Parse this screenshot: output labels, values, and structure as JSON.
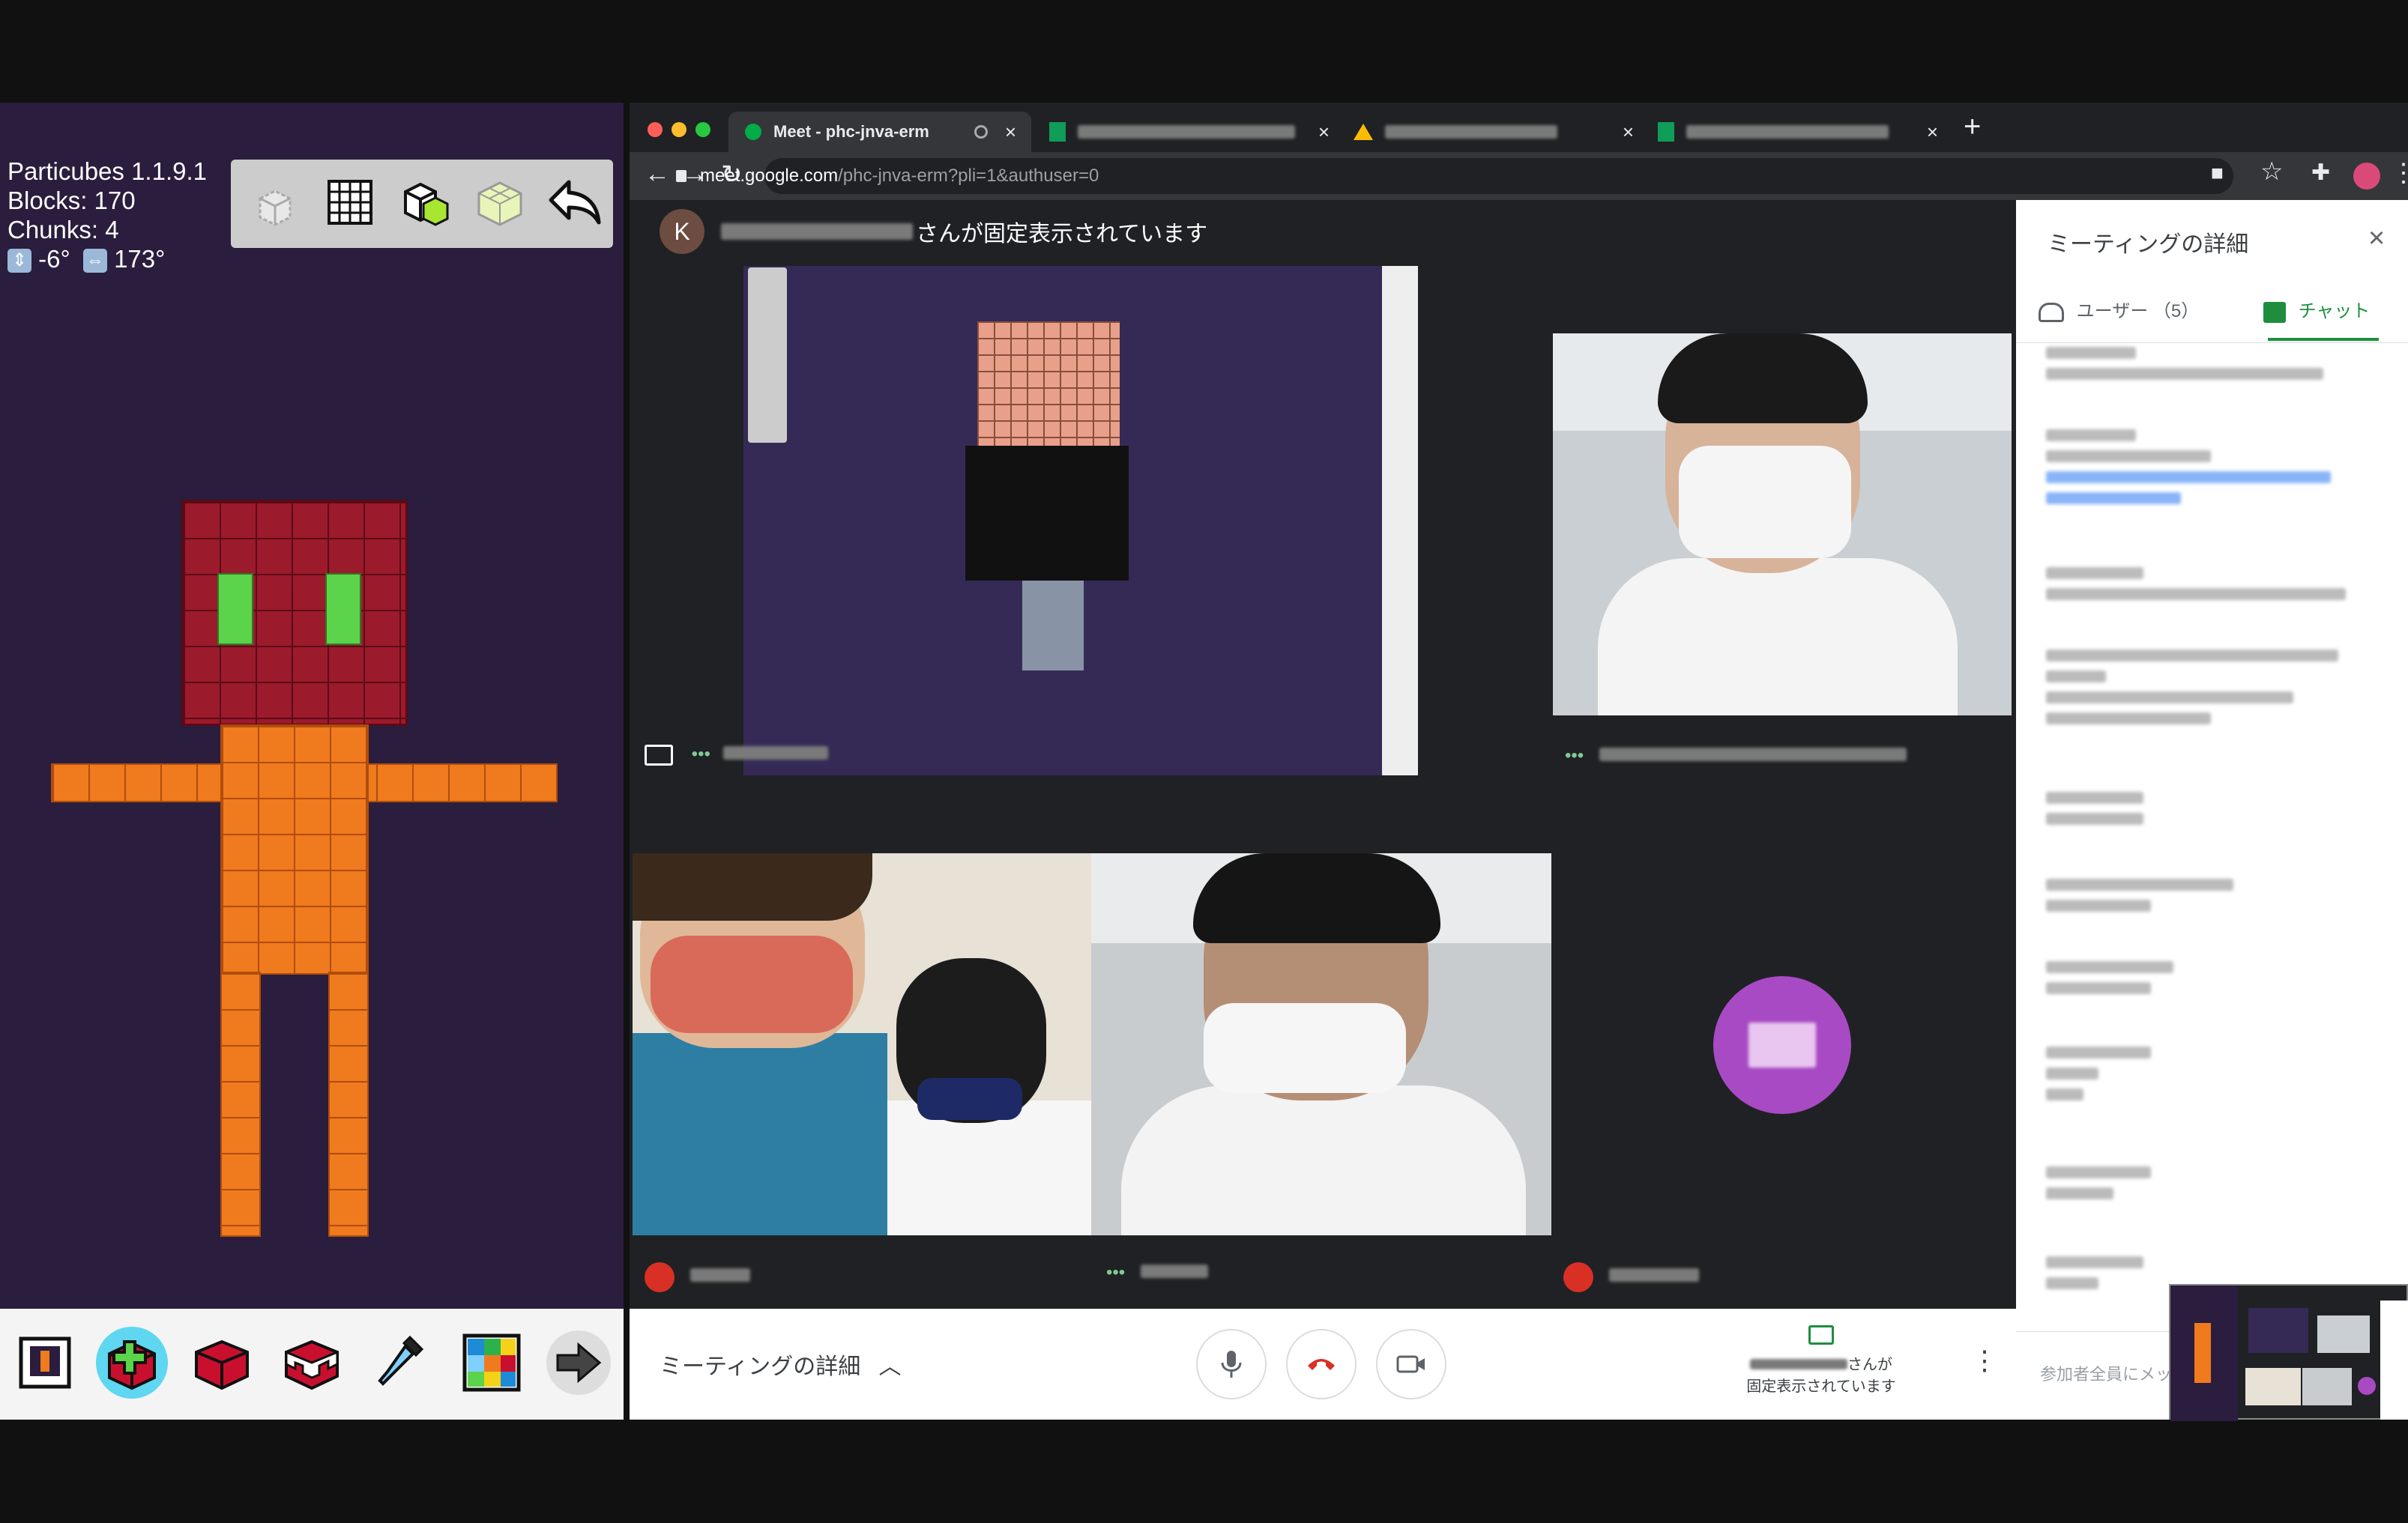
{
  "particubes": {
    "stats": {
      "version": "Particubes 1.1.9.1",
      "blocks": "Blocks: 170",
      "chunks": "Chunks: 4",
      "angle_v": "-6°",
      "angle_h": "173°"
    },
    "toolbar_icons": [
      "select-cube-icon",
      "grid-icon",
      "add-block-icon",
      "fill-block-icon",
      "undo-icon"
    ],
    "bottom_icons": [
      "photo-icon",
      "add-block-icon",
      "place-block-icon",
      "paint-block-icon",
      "eyedropper-icon",
      "palette-icon",
      "next-arrow-icon"
    ],
    "colors": {
      "head": "#9b1a2c",
      "eyes": "#5bd34a",
      "body": "#f07a1e",
      "bg": "#2a1d3d"
    }
  },
  "browser": {
    "tabs": [
      {
        "label": "Meet - phc-jnva-erm",
        "active": true
      },
      {
        "label": "",
        "active": false
      },
      {
        "label": "",
        "active": false
      },
      {
        "label": "",
        "active": false
      }
    ],
    "url_host": "meet.google.com",
    "url_path": "/phc-jnva-erm?pli=1&authuser=0"
  },
  "meet": {
    "avatar_letter": "K",
    "pin_banner": "さんが固定表示されています",
    "panel": {
      "title": "ミーティングの詳細",
      "tab_users": "ユーザー （5）",
      "tab_chat": "チャット",
      "input_placeholder": "参加者全員にメッ"
    },
    "bottom": {
      "details_label": "ミーティングの詳細",
      "pinned_line1": "さんが",
      "pinned_line2": "固定表示されています"
    }
  }
}
